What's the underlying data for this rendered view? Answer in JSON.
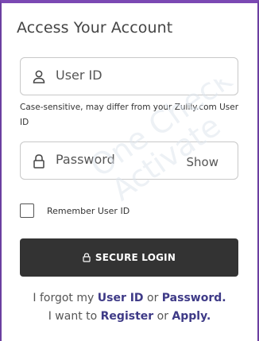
{
  "header": {
    "title": "Access Your Account"
  },
  "user_field": {
    "icon": "user-icon",
    "placeholder": "User ID",
    "hint": "Case-sensitive, may differ from your Zulily.com User ID"
  },
  "password_field": {
    "icon": "lock-icon",
    "placeholder": "Password",
    "show_label": "Show"
  },
  "remember": {
    "label": "Remember User ID",
    "checked": false
  },
  "login_button": {
    "icon": "lock-icon",
    "label": "SECURE LOGIN"
  },
  "links": {
    "forgot_prefix": "I forgot my",
    "user_id_link": "User ID",
    "or1": "or",
    "password_link": "Password.",
    "want_prefix": "I want to",
    "register_link": "Register",
    "or2": "or",
    "apply_link": "Apply."
  },
  "watermark_text": [
    "One Check",
    "Activate"
  ],
  "colors": {
    "accent": "#6b3fa0",
    "button": "#333333",
    "link": "#3e3a87"
  }
}
